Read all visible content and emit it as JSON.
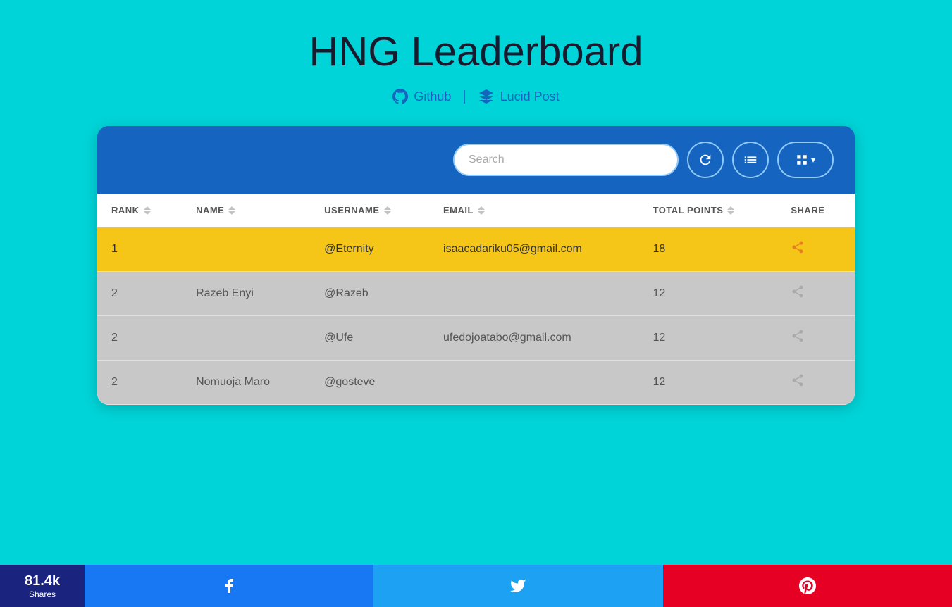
{
  "page": {
    "title": "HNG Leaderboard",
    "background_color": "#00d4d8"
  },
  "header": {
    "github_label": "Github",
    "lucidpost_label": "Lucid Post",
    "divider": "|"
  },
  "toolbar": {
    "search_placeholder": "Search",
    "refresh_icon": "⟳",
    "list_icon": "☰",
    "grid_icon": "⊞",
    "dropdown_arrow": "▾"
  },
  "table": {
    "columns": [
      "RANK",
      "NAME",
      "USERNAME",
      "EMAIL",
      "TOTAL POINTS",
      "SHARE"
    ],
    "rows": [
      {
        "rank": "1",
        "name": "",
        "username": "@Eternity",
        "email": "isaacadariku05@gmail.com",
        "total_points": "18",
        "row_class": "rank-1"
      },
      {
        "rank": "2",
        "name": "Razeb Enyi",
        "username": "@Razeb",
        "email": "",
        "total_points": "12",
        "row_class": "rank-other"
      },
      {
        "rank": "2",
        "name": "",
        "username": "@Ufe",
        "email": "ufedojoatabo@gmail.com",
        "total_points": "12",
        "row_class": "rank-other"
      },
      {
        "rank": "2",
        "name": "Nomuoja Maro",
        "username": "@gosteve",
        "email": "",
        "total_points": "12",
        "row_class": "rank-other"
      }
    ]
  },
  "social_bar": {
    "count": "81.4k",
    "shares_label": "Shares",
    "facebook_icon": "f",
    "twitter_icon": "🐦",
    "pinterest_icon": "P"
  }
}
